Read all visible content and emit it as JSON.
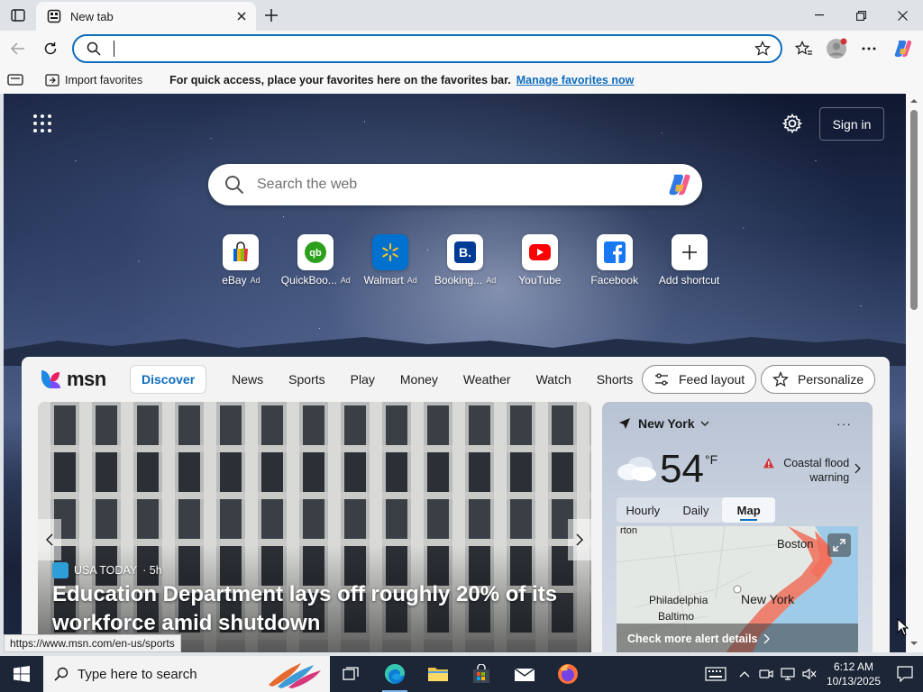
{
  "browser": {
    "tab_title": "New tab",
    "address_value": "",
    "favorites_bar": {
      "import_label": "Import favorites",
      "message": "For quick access, place your favorites here on the favorites bar.",
      "manage_link": "Manage favorites now"
    },
    "status_url": "https://www.msn.com/en-us/sports"
  },
  "ntp": {
    "signin_label": "Sign in",
    "search_placeholder": "Search the web",
    "shortcuts": [
      {
        "label": "eBay",
        "ad": "Ad",
        "icon": "ebay-icon"
      },
      {
        "label": "QuickBoo...",
        "ad": "Ad",
        "icon": "quickbooks-icon"
      },
      {
        "label": "Walmart",
        "ad": "Ad",
        "icon": "walmart-icon"
      },
      {
        "label": "Booking...",
        "ad": "Ad",
        "icon": "booking-icon"
      },
      {
        "label": "YouTube",
        "ad": "",
        "icon": "youtube-icon"
      },
      {
        "label": "Facebook",
        "ad": "",
        "icon": "facebook-icon"
      },
      {
        "label": "Add shortcut",
        "ad": "",
        "icon": "plus-icon"
      }
    ]
  },
  "feed": {
    "brand": "msn",
    "nav": [
      "Discover",
      "News",
      "Sports",
      "Play",
      "Money",
      "Weather",
      "Watch",
      "Shorts"
    ],
    "more": "···",
    "feed_layout_label": "Feed layout",
    "personalize_label": "Personalize",
    "hero": {
      "source": "USA TODAY",
      "age": "· 5h",
      "title": "Education Department lays off roughly 20% of its workforce amid shutdown"
    },
    "weather": {
      "location": "New York",
      "more": "···",
      "temp": "54",
      "unit": "°F",
      "alert": "Coastal flood warning",
      "tabs": [
        "Hourly",
        "Daily",
        "Map"
      ],
      "active_tab": "Map",
      "map_labels": {
        "boston": "Boston",
        "philadelphia": "Philadelphia",
        "baltimore": "Baltimo",
        "newyork": "New York",
        "top_fragment": "rton"
      },
      "map_footer": "Check more alert details"
    }
  },
  "taskbar": {
    "search_placeholder": "Type here to search",
    "time": "6:12 AM",
    "date": "10/13/2025"
  },
  "colors": {
    "accent": "#0f6cbd",
    "taskbar": "#1c2636",
    "alert_red": "#d13438"
  }
}
